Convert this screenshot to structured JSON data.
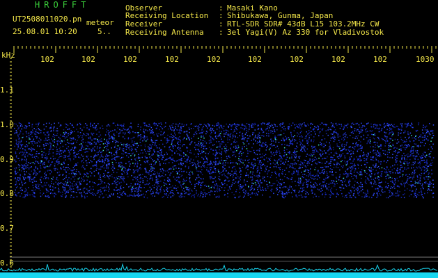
{
  "app": {
    "brand": "HROFFT",
    "file_name": "UT2508011020.pn",
    "overlay_label": "meteor",
    "date_time": "25.08.01 10:20",
    "count": "5.."
  },
  "header": {
    "rows": [
      {
        "key": "Observer",
        "value": "Masaki Kano"
      },
      {
        "key": "Receiving Location",
        "value": "Shibukawa, Gunma, Japan"
      },
      {
        "key": "Receiver",
        "value": "RTL-SDR SDR# 43dB L15 103.2MHz CW"
      },
      {
        "key": "Receiving Antenna",
        "value": "3el Yagi(V) Az 330 for Vladivostok"
      }
    ]
  },
  "axes": {
    "unit": "kHz",
    "x_labels": [
      "102",
      "102",
      "102",
      "102",
      "102",
      "102",
      "102",
      "102",
      "102",
      "1030"
    ],
    "y_labels": [
      "1.1",
      "1.0",
      "0.9",
      "0.8",
      "0.7",
      "0.6"
    ]
  },
  "colors": {
    "label": "#f5e84a",
    "brand": "#3bd13b",
    "noise_band": "#1a2fd6",
    "baseline_trace": "#18d6f0"
  }
}
